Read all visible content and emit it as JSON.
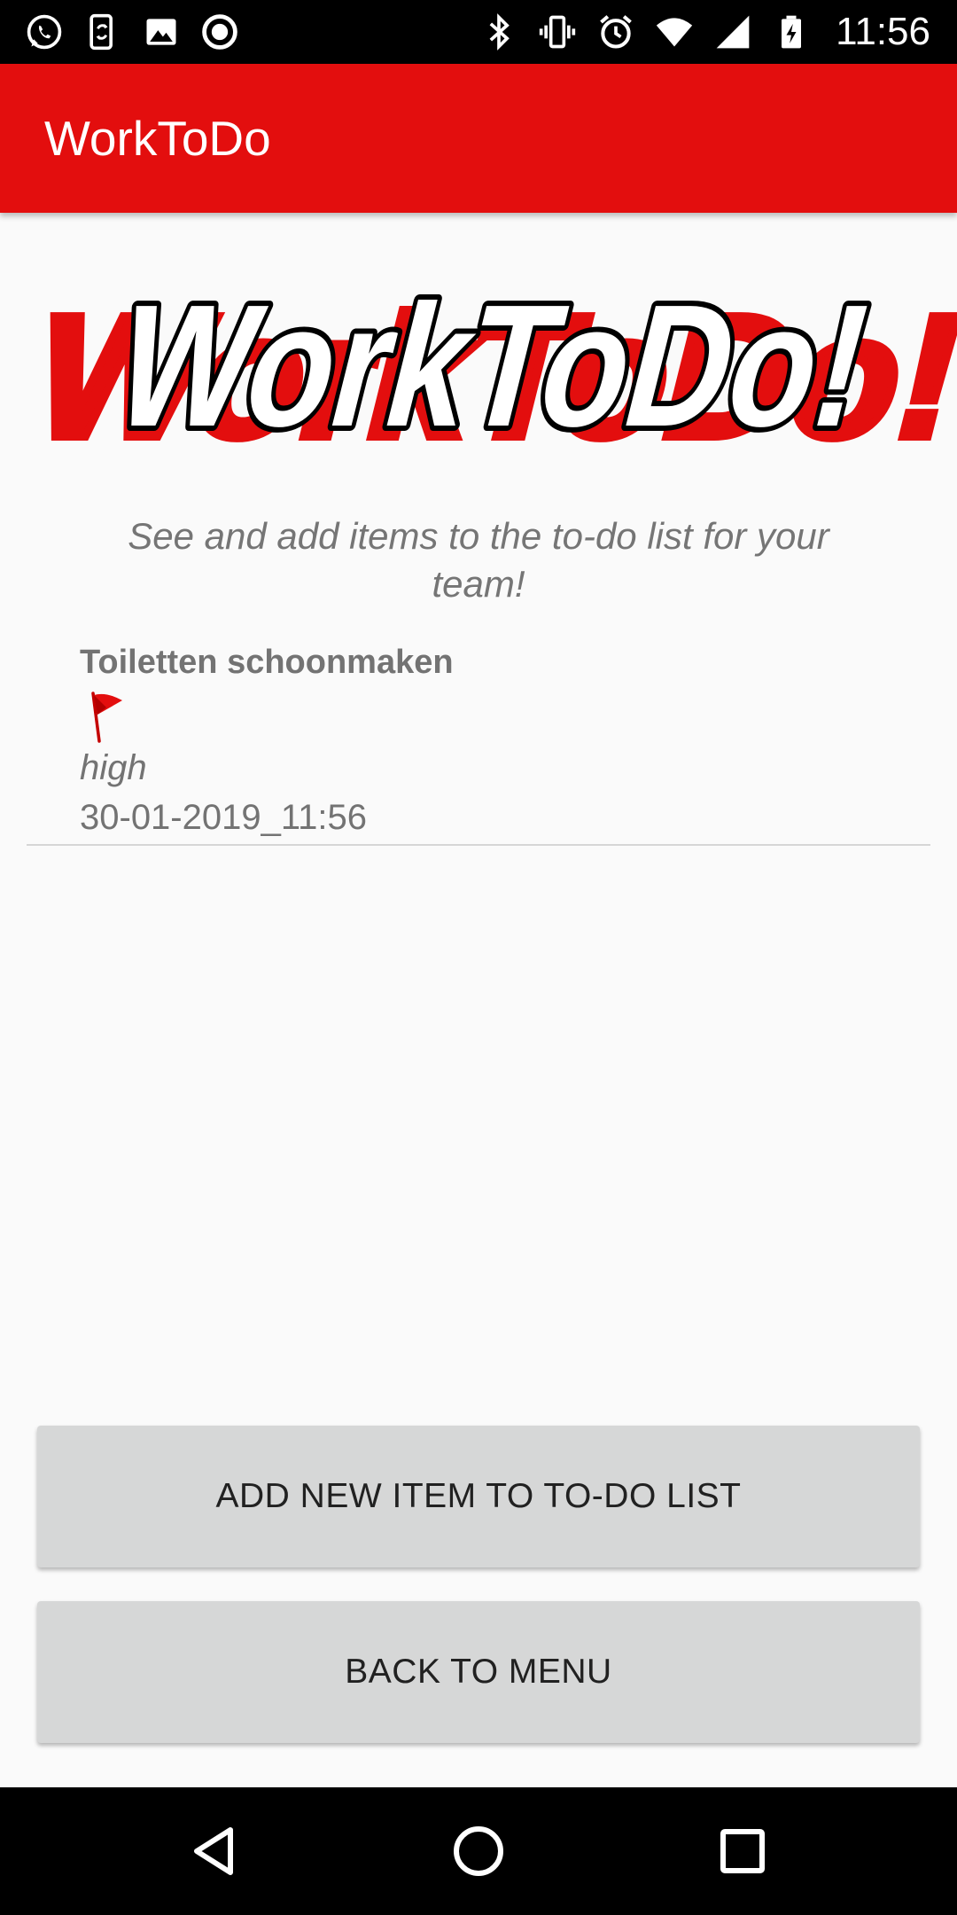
{
  "status_bar": {
    "time": "11:56",
    "left_icons": [
      "whatsapp-icon",
      "phone-sync-icon",
      "image-icon",
      "record-icon"
    ],
    "right_icons": [
      "bluetooth-icon",
      "vibrate-icon",
      "alarm-icon",
      "wifi-icon",
      "signal-icon",
      "battery-charging-icon"
    ]
  },
  "app_bar": {
    "title": "WorkToDo"
  },
  "logo": {
    "text": "WorkToDo!",
    "colors": {
      "fill": "#ffffff",
      "outline": "#000000",
      "shadow": "#e30e0e"
    }
  },
  "subtitle": "See and add items to the to-do list for your team!",
  "todo_items": [
    {
      "title": "Toiletten schoonmaken",
      "flag_icon": "red-flag-icon",
      "priority": "high",
      "date": "30-01-2019_11:56"
    }
  ],
  "buttons": {
    "add_label": "ADD NEW ITEM TO TO-DO LIST",
    "back_label": "BACK TO MENU"
  },
  "nav_bar": {
    "icons": [
      "back-icon",
      "home-icon",
      "recents-icon"
    ]
  },
  "colors": {
    "accent": "#e30e0e",
    "button_bg": "#d6d7d7",
    "text_grey": "#737373",
    "background": "#fafafa"
  }
}
